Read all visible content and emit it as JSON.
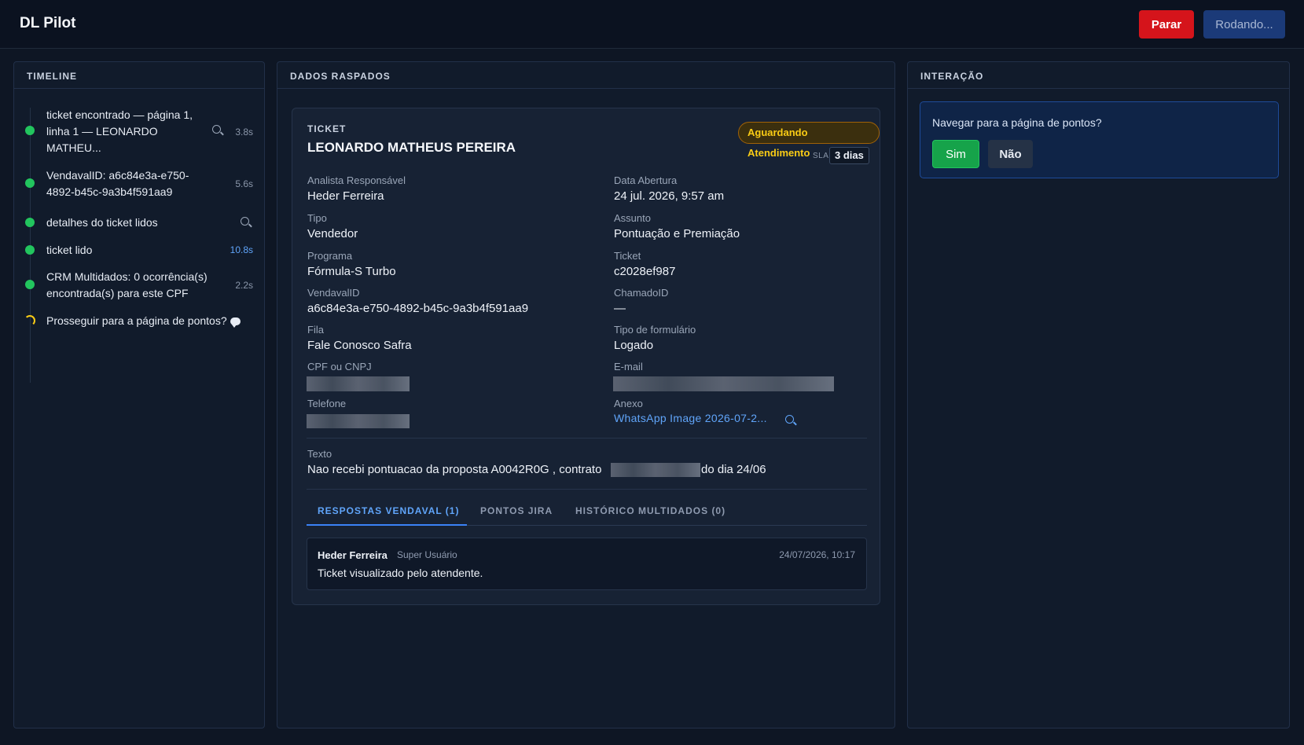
{
  "app": {
    "title": "DL Pilot"
  },
  "header": {
    "stop_label": "Parar",
    "running_label": "Rodando..."
  },
  "colors": {
    "success": "#22c55e",
    "danger": "#d5141b",
    "accent": "#3b82f6",
    "warning": "#facc15"
  },
  "timeline": {
    "title": "TIMELINE",
    "items": [
      {
        "text": "ticket encontrado — página 1, linha 1 — LEONARDO MATHEU...",
        "time": "3.8s",
        "icon": "search-icon",
        "status": "done"
      },
      {
        "text": "VendavalID: a6c84e3a-e750-4892-b45c-9a3b4f591aa9",
        "time": "5.6s",
        "status": "done"
      },
      {
        "text": "detalhes do ticket lidos",
        "time": "",
        "icon": "search-icon",
        "status": "done"
      },
      {
        "text": "ticket lido",
        "time": "10.8s",
        "status": "done"
      },
      {
        "text": "CRM Multidados: 0 ocorrência(s) encontrada(s) para este CPF",
        "time": "2.2s",
        "status": "done"
      },
      {
        "text": "Prosseguir para a página de pontos?",
        "time": "",
        "icon": "chat-icon",
        "status": "pending"
      }
    ]
  },
  "scraped": {
    "title": "DADOS RASPADOS",
    "ticket_label": "TICKET",
    "customer_name": "LEONARDO MATHEUS PEREIRA",
    "status": "Aguardando Atendimento",
    "sla_label": "SLA",
    "sla_value": "3 dias",
    "fields": {
      "analyst": {
        "label": "Analista Responsável",
        "value": "Heder Ferreira"
      },
      "opened": {
        "label": "Data Abertura",
        "value": "24 jul. 2026, 9:57 am"
      },
      "type": {
        "label": "Tipo",
        "value": "Vendedor"
      },
      "subject": {
        "label": "Assunto",
        "value": "Pontuação e Premiação"
      },
      "program": {
        "label": "Programa",
        "value": "Fórmula-S Turbo"
      },
      "ticket": {
        "label": "Ticket",
        "value": "c2028ef987"
      },
      "vendaval_id": {
        "label": "VendavalID",
        "value": "a6c84e3a-e750-4892-b45c-9a3b4f591aa9"
      },
      "chamado_id": {
        "label": "ChamadoID",
        "value": "—"
      },
      "queue": {
        "label": "Fila",
        "value": "Fale Conosco Safra"
      },
      "form_type": {
        "label": "Tipo de formulário",
        "value": "Logado"
      },
      "cpf": {
        "label": "CPF ou CNPJ"
      },
      "email": {
        "label": "E-mail"
      },
      "phone": {
        "label": "Telefone"
      },
      "attachment": {
        "label": "Anexo",
        "value": "WhatsApp Image 2026-07-2..."
      }
    },
    "text_label": "Texto",
    "text_before": "Nao recebi pontuacao da proposta A0042R0G , contrato",
    "text_after": "do dia 24/06",
    "tabs": [
      {
        "label": "RESPOSTAS VENDAVAL (1)",
        "active": true
      },
      {
        "label": "PONTOS JIRA",
        "active": false
      },
      {
        "label": "HISTÓRICO MULTIDADOS (0)",
        "active": false
      }
    ],
    "responses": [
      {
        "author": "Heder Ferreira",
        "role": "Super Usuário",
        "date": "24/07/2026, 10:17",
        "message": "Ticket visualizado pelo atendente."
      }
    ]
  },
  "interaction": {
    "title": "INTERAÇÃO",
    "question": "Navegar para a página de pontos?",
    "yes_label": "Sim",
    "no_label": "Não"
  }
}
